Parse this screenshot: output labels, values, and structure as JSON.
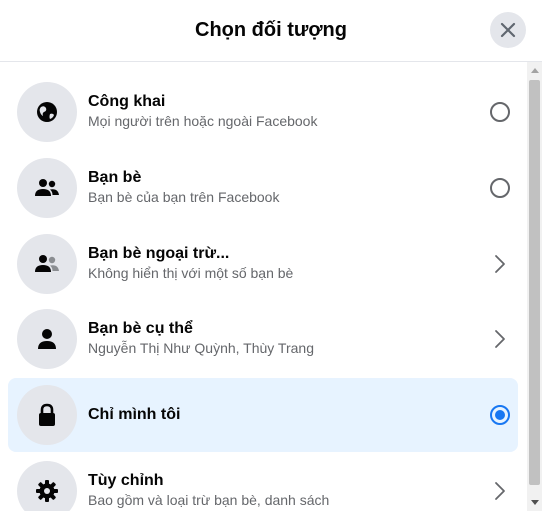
{
  "header": {
    "title": "Chọn đối tượng"
  },
  "items": [
    {
      "title": "Công khai",
      "subtitle": "Mọi người trên hoặc ngoài Facebook",
      "icon": "globe-icon",
      "control": "radio",
      "selected": false
    },
    {
      "title": "Bạn bè",
      "subtitle": "Bạn bè của bạn trên Facebook",
      "icon": "friends-icon",
      "control": "radio",
      "selected": false
    },
    {
      "title": "Bạn bè ngoại trừ...",
      "subtitle": "Không hiển thị với một số bạn bè",
      "icon": "friends-except-icon",
      "control": "chevron",
      "selected": false
    },
    {
      "title": "Bạn bè cụ thể",
      "subtitle": "Nguyễn Thị Như Quỳnh, Thùy Trang",
      "icon": "person-icon",
      "control": "chevron",
      "selected": false
    },
    {
      "title": "Chỉ mình tôi",
      "subtitle": "",
      "icon": "lock-icon",
      "control": "radio",
      "selected": true
    },
    {
      "title": "Tùy chỉnh",
      "subtitle": "Bao gồm và loại trừ bạn bè, danh sách",
      "icon": "gear-icon",
      "control": "chevron",
      "selected": false
    }
  ],
  "colors": {
    "accent": "#1877f2",
    "selected_bg": "#e7f3ff",
    "icon_bg": "#e4e6eb"
  }
}
